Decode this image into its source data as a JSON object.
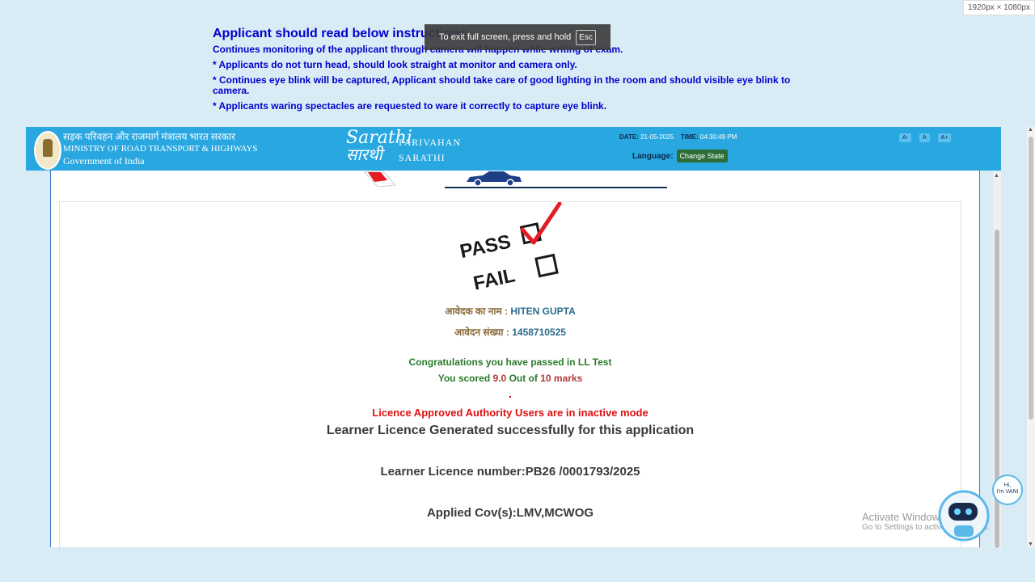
{
  "screen_badge": "1920px × 1080px",
  "instructions": {
    "title": "Applicant should read below instructions",
    "lines": [
      "Continues monitoring of the applicant through camera will happen while writing of exam.",
      "* Applicants do not turn head, should look straight at monitor and camera only.",
      "* Continues eye blink will be captured, Applicant should take care of good lighting in the room and should visible eye blink to camera.",
      "* Applicants waring spectacles are requested to ware it correctly to capture eye blink."
    ]
  },
  "fullscreen_toast": {
    "text": "To exit full screen, press and hold",
    "key": "Esc"
  },
  "header": {
    "ministry_hindi": "सड़क परिवहन और राजमार्ग मंत्रालय भारत सरकार",
    "ministry_english": "MINISTRY OF ROAD TRANSPORT & HIGHWAYS",
    "government": "Government of India",
    "logo_text_1": "Sarathi",
    "logo_text_2": "सारथी",
    "parivahan": "PARIVAHAN",
    "sarathi": "SARATHI",
    "date_label": "DATE:",
    "date_value": "21-05-2025",
    "time_label": "TIME:",
    "time_value": "04:30:49 PM",
    "language_label": "Language:",
    "change_state": "Change State",
    "font_small": "A-",
    "font_normal": "A",
    "font_large": "A+"
  },
  "result": {
    "pass_label": "PASS",
    "fail_label": "FAIL",
    "applicant_name_label": "आवेदक का नाम :",
    "applicant_name": "HITEN GUPTA",
    "application_no_label": "आवेदन संख्या :",
    "application_no": "1458710525",
    "congrats": "Congratulations you have passed in LL Test",
    "scored_prefix": "You scored",
    "score": "9.0",
    "out_of": "Out of",
    "total": "10 marks",
    "inactive_msg": "Licence Approved Authority Users are in inactive mode",
    "generated_msg": "Learner Licence Generated successfully for this application",
    "ll_number": "Learner Licence number:PB26 /0001793/2025",
    "applied_cov": "Applied Cov(s):LMV,MCWOG"
  },
  "watermark": {
    "line1": "Activate Windows",
    "line2": "Go to Settings to activate Windows."
  },
  "bot": {
    "greeting_1": "Hi,",
    "greeting_2": "I'm VANI"
  },
  "colors": {
    "header_bg": "#29a7e1",
    "page_bg": "#d9ecf6",
    "instructions": "#0000cc",
    "error": "#e01010"
  }
}
